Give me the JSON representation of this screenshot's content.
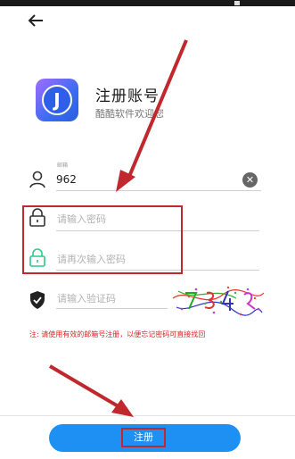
{
  "header": {
    "back_icon": "arrow-left-icon"
  },
  "app": {
    "logo_letter": "J",
    "title": "注册账号",
    "subtitle": "酷酷软件欢迎您"
  },
  "form": {
    "email": {
      "floating_label": "邮箱",
      "value": "962",
      "icon": "user-icon",
      "clear_icon": "clear-icon"
    },
    "password": {
      "placeholder": "请输入密码",
      "icon": "lock-icon"
    },
    "confirm_password": {
      "placeholder": "请再次输入密码",
      "icon": "lock-green-icon"
    },
    "captcha": {
      "placeholder": "请输入验证码",
      "icon": "shield-check-icon"
    }
  },
  "notice": "注: 请使用有效的邮箱号注册，以便忘记密码可直接找回",
  "register_button": {
    "label": "注册"
  },
  "colors": {
    "accent": "#1e90f3",
    "annotation_red": "#c0282d",
    "notice_red": "#e02020",
    "lock_green": "#2fc98a"
  }
}
